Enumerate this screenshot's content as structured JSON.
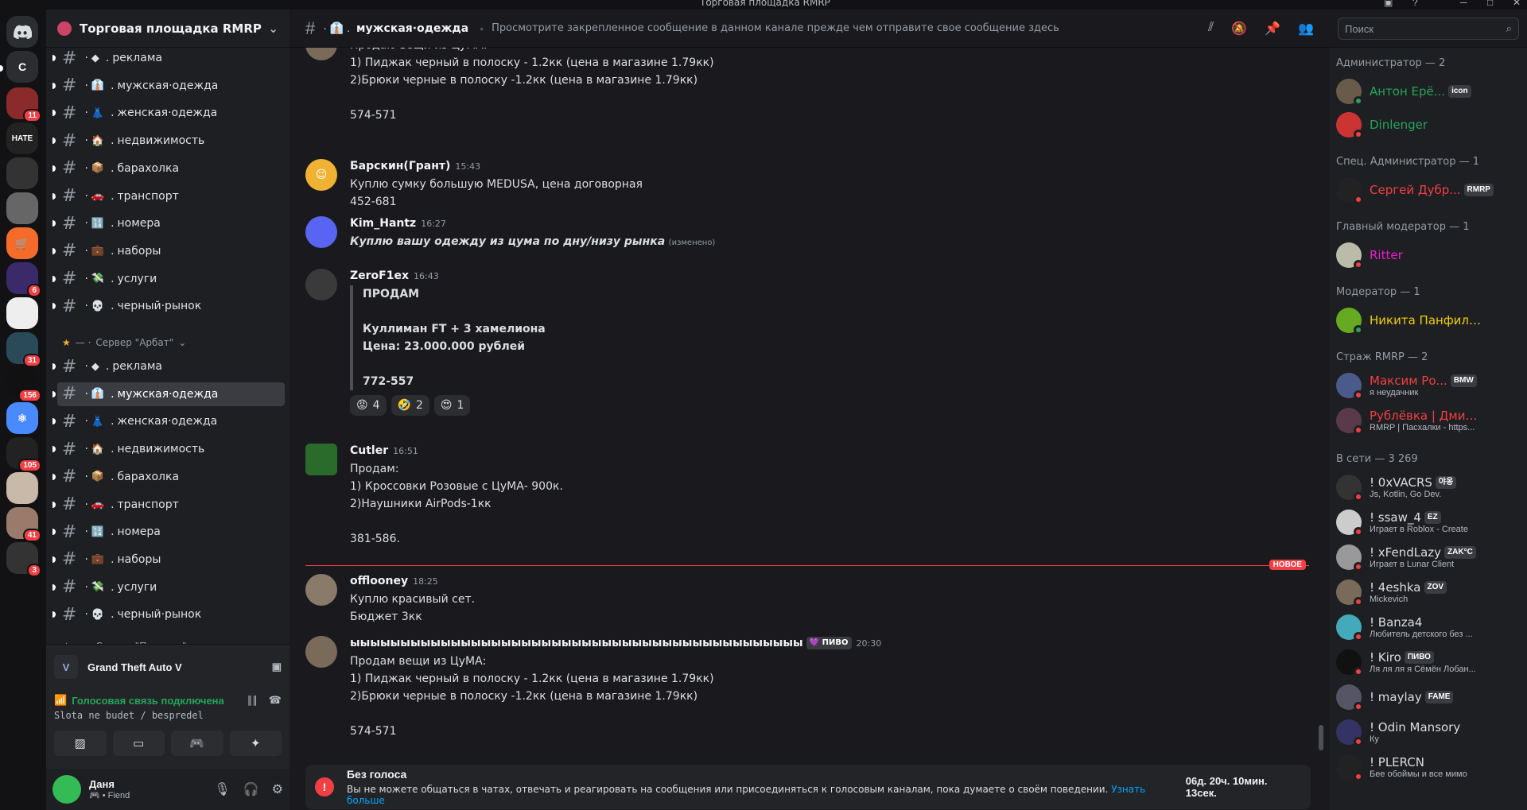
{
  "window": {
    "title": "Торговая площадка RMRP"
  },
  "guilds": [
    {
      "label": "C"
    },
    {
      "badge": "11"
    },
    {
      "label": "HATE"
    },
    {
      "badge": ""
    },
    {
      "badge": ""
    },
    {
      "badge": ""
    },
    {
      "badge": "6"
    },
    {
      "badge": ""
    },
    {
      "badge": "31"
    },
    {
      "badge": "156"
    },
    {
      "badge": ""
    },
    {
      "badge": "105"
    },
    {
      "badge": ""
    },
    {
      "badge": "41"
    },
    {
      "badge": "3"
    }
  ],
  "server": {
    "name": "Торговая площадка RMRP"
  },
  "channels_top": [
    {
      "name": "реклама",
      "emoji": "◆"
    },
    {
      "name": "мужская·одежда",
      "emoji": "👔"
    },
    {
      "name": "женская·одежда",
      "emoji": "👗"
    },
    {
      "name": "недвижимость",
      "emoji": "🏠"
    },
    {
      "name": "барахолка",
      "emoji": "📦"
    },
    {
      "name": "транспорт",
      "emoji": "🚗"
    },
    {
      "name": "номера",
      "emoji": "🔢"
    },
    {
      "name": "наборы",
      "emoji": "💼"
    },
    {
      "name": "услуги",
      "emoji": "💸"
    },
    {
      "name": "черный·рынок",
      "emoji": "💀"
    }
  ],
  "category_arbat": "Сервер \"Арбат\"",
  "channels_arbat": [
    {
      "name": "реклама",
      "emoji": "◆"
    },
    {
      "name": "мужская·одежда",
      "emoji": "👔"
    },
    {
      "name": "женская·одежда",
      "emoji": "👗"
    },
    {
      "name": "недвижимость",
      "emoji": "🏠"
    },
    {
      "name": "барахолка",
      "emoji": "📦"
    },
    {
      "name": "транспорт",
      "emoji": "🚗"
    },
    {
      "name": "номера",
      "emoji": "🔢"
    },
    {
      "name": "наборы",
      "emoji": "💼"
    },
    {
      "name": "услуги",
      "emoji": "💸"
    },
    {
      "name": "черный·рынок",
      "emoji": "💀"
    }
  ],
  "category_patriki": "Сервер \"Патрики\"",
  "activity": {
    "game": "Grand Theft Auto V"
  },
  "voice": {
    "status": "Голосовая связь подключена",
    "where": "Slota ne budet / bespredel"
  },
  "user": {
    "name": "Даня",
    "status": "Fiend"
  },
  "channel": {
    "name": "мужская·одежда",
    "topic": "Просмотрите закрепленное сообщение в данном канале прежде чем отправите свое сообщение здесь"
  },
  "search": {
    "placeholder": "Поиск"
  },
  "messages": {
    "m0": {
      "lines": [
        "Продаю вещи из ЦуМА:",
        "1) Пиджак черный в полоску - 1.2кк (цена в магазине 1.79кк)",
        "2)Брюки черные в полоску -1.2кк (цена в магазине 1.79кк)",
        "",
        "574-571"
      ]
    },
    "m1": {
      "author": "Барскин(Грант)",
      "time": "15:43",
      "lines": [
        "Куплю сумку большую MEDUSA, цена договорная",
        "452-681"
      ]
    },
    "m2": {
      "author": "Kim_Hantz",
      "time": "16:27",
      "line": "Куплю вашу одежду из цума по дну/низу рынка",
      "edited": "(изменено)"
    },
    "m3": {
      "author": "ZeroF1ex",
      "time": "16:43",
      "quote": [
        "ПРОДАМ",
        "",
        "Куллиман FT + 3 хамелиона",
        "Цена: 23.000.000 рублей",
        "",
        "772-557"
      ],
      "reactions": [
        {
          "emoji": "😡",
          "count": "4"
        },
        {
          "emoji": "🤣",
          "count": "2"
        },
        {
          "emoji": "😍",
          "count": "1"
        }
      ]
    },
    "m4": {
      "author": "Cutler",
      "time": "16:51",
      "lines": [
        "Продам:",
        "1) Кроссовки Розовые с ЦуМА- 900к.",
        "2)Наушники AirPods-1кк",
        "",
        "381-586."
      ]
    },
    "new_label": "НОВОЕ",
    "m5": {
      "author": "offlooney",
      "time": "18:25",
      "lines": [
        "Куплю красивый сет.",
        "Бюджет 3кк"
      ]
    },
    "m6": {
      "author": "ыыыыыыыыыыыыыыыыыыыыыыыыыыыыыыыыыыыыыыыыыыыыы",
      "tag": "ПИВО",
      "time": "20:30",
      "lines": [
        "Продам вещи из ЦуМА:",
        "1) Пиджак черный в полоску - 1.2кк (цена в магазине 1.79кк)",
        "2)Брюки черные в полоску -1.2кк (цена в магазине 1.79кк)",
        "",
        "574-571"
      ]
    }
  },
  "banner": {
    "title": "Без голоса",
    "desc": "Вы не можете общаться в чатах, отвечать и реагировать на сообщения или присоединяться к голосовым каналам, пока думаете о своём поведении.",
    "link": "Узнать больше",
    "timer": "06д. 20ч. 10мин. 13сек."
  },
  "members": {
    "admin_cat": "Администратор — 2",
    "admin": [
      {
        "name": "Антон Ерё...",
        "color": "#23a55a",
        "tag": "icon",
        "online": true
      },
      {
        "name": "Dinlenger",
        "color": "#23a55a",
        "online": false
      }
    ],
    "spec_cat": "Спец. Администратор — 1",
    "spec": [
      {
        "name": "Сергей Дубр...",
        "color": "#f23f43",
        "tag": "RMRP"
      }
    ],
    "head_cat": "Главный модератор — 1",
    "head": [
      {
        "name": "Ritter",
        "color": "#e91ecb"
      }
    ],
    "mod_cat": "Модератор — 1",
    "mod": [
      {
        "name": "Никита Панфилов",
        "color": "#f0d000",
        "online": true
      }
    ],
    "guard_cat": "Страж RMRP — 2",
    "guard": [
      {
        "name": "Максим Ро...",
        "color": "#f23f43",
        "tag": "BMW",
        "activity": "я неудачник"
      },
      {
        "name": "Рублёвка | Дмитри...",
        "color": "#f23f43",
        "activity": "RMRP | Пасхалки - https..."
      }
    ],
    "online_cat": "В сети — 3 269",
    "online": [
      {
        "name": "! 0xVACRS",
        "tag": "야옹",
        "activity": "Js, Kotlin, Go Dev."
      },
      {
        "name": "! ssaw_4",
        "tag": "EZ",
        "activity": "Играет в Roblox - Create"
      },
      {
        "name": "! xFendLazy",
        "tag": "ZAK°C",
        "activity": "Играет в Lunar Client"
      },
      {
        "name": "! 4eshka",
        "tag": "ZOV",
        "activity": "Mickevich"
      },
      {
        "name": "! Banza4",
        "activity": "Любитель детского без ..."
      },
      {
        "name": "! Kiro",
        "tag": "ПИВО",
        "activity": "Ля ля ля я Сёмён Лобан..."
      },
      {
        "name": "! maylay",
        "tag": "FAME",
        "activity": ""
      },
      {
        "name": "! Odin Mansory",
        "activity": "Ку"
      },
      {
        "name": "! PLERCN",
        "activity": "Бее обоймы и все мимо"
      }
    ]
  }
}
